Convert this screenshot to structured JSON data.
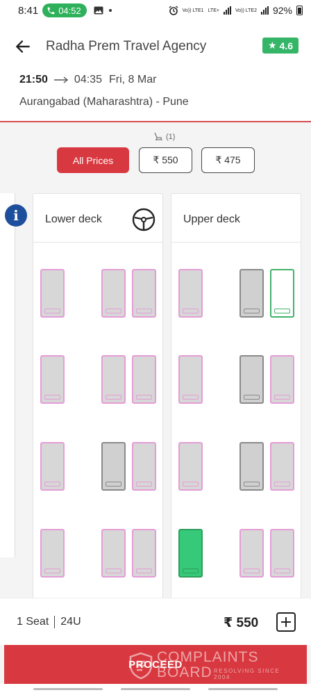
{
  "status_bar": {
    "time": "8:41",
    "call_timer": "04:52",
    "battery": "92%",
    "sim1_label": "Vo)) LTE1",
    "lte_plus": "LTE+",
    "sim2_label": "Vo)) LTE2"
  },
  "header": {
    "title": "Radha Prem Travel Agency",
    "rating": "4.6",
    "departure": "21:50",
    "arrival": "04:35",
    "date": "Fri, 8 Mar",
    "route": "Aurangabad (Maharashtra) - Pune"
  },
  "filter": {
    "selected_count": "(1)",
    "chips": [
      {
        "label": "All Prices",
        "active": true
      },
      {
        "label": "₹ 550",
        "active": false
      },
      {
        "label": "₹ 475",
        "active": false
      }
    ]
  },
  "info_button": "i",
  "lower_deck": {
    "label": "Lower deck",
    "seats": [
      {
        "row": 0,
        "col": 0,
        "status": "available"
      },
      {
        "row": 0,
        "col": 2,
        "status": "available"
      },
      {
        "row": 0,
        "col": 3,
        "status": "available"
      },
      {
        "row": 1,
        "col": 0,
        "status": "available"
      },
      {
        "row": 1,
        "col": 2,
        "status": "available"
      },
      {
        "row": 1,
        "col": 3,
        "status": "available"
      },
      {
        "row": 2,
        "col": 0,
        "status": "available"
      },
      {
        "row": 2,
        "col": 2,
        "status": "booked"
      },
      {
        "row": 2,
        "col": 3,
        "status": "available"
      },
      {
        "row": 3,
        "col": 0,
        "status": "available"
      },
      {
        "row": 3,
        "col": 2,
        "status": "available"
      },
      {
        "row": 3,
        "col": 3,
        "status": "available"
      }
    ]
  },
  "upper_deck": {
    "label": "Upper deck",
    "seats": [
      {
        "row": 0,
        "col": 0,
        "status": "available"
      },
      {
        "row": 0,
        "col": 2,
        "status": "booked"
      },
      {
        "row": 0,
        "col": 3,
        "status": "free"
      },
      {
        "row": 1,
        "col": 0,
        "status": "available"
      },
      {
        "row": 1,
        "col": 2,
        "status": "booked"
      },
      {
        "row": 1,
        "col": 3,
        "status": "available"
      },
      {
        "row": 2,
        "col": 0,
        "status": "available"
      },
      {
        "row": 2,
        "col": 2,
        "status": "booked"
      },
      {
        "row": 2,
        "col": 3,
        "status": "available"
      },
      {
        "row": 3,
        "col": 0,
        "status": "selected"
      },
      {
        "row": 3,
        "col": 2,
        "status": "available"
      },
      {
        "row": 3,
        "col": 3,
        "status": "available"
      }
    ]
  },
  "bottom_bar": {
    "seats_label": "1 Seat",
    "seat_number": "24U",
    "price": "₹ 550",
    "proceed_label": "PROCEED"
  },
  "watermark": {
    "line1": "COMPLAINTS",
    "line2": "BOARD",
    "line3": "RESOLVING SINCE 2004"
  },
  "colors": {
    "accent": "#d8383f",
    "rating_bg": "#35b568",
    "available_seat_border": "#e59cd6",
    "booked_seat_border": "#8a8a8a",
    "selected_seat": "#37c97a",
    "info_button": "#1e4f9c"
  }
}
